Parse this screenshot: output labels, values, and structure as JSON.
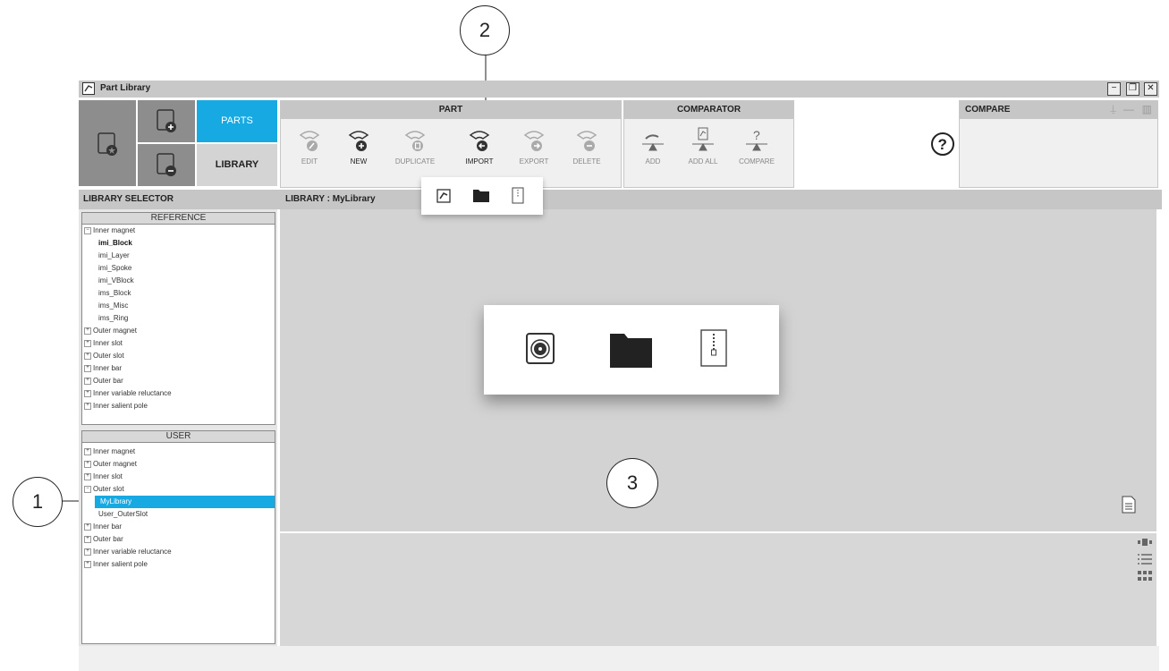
{
  "window": {
    "title": "Part Library"
  },
  "tiles": {
    "parts_label": "PARTS",
    "library_label": "LIBRARY"
  },
  "part": {
    "header": "PART",
    "buttons": [
      {
        "label": "EDIT",
        "enabled": false
      },
      {
        "label": "NEW",
        "enabled": true
      },
      {
        "label": "DUPLICATE",
        "enabled": false
      },
      {
        "label": "IMPORT",
        "enabled": true
      },
      {
        "label": "EXPORT",
        "enabled": false
      },
      {
        "label": "DELETE",
        "enabled": false
      }
    ]
  },
  "comparator": {
    "header": "COMPARATOR",
    "buttons": [
      {
        "label": "ADD"
      },
      {
        "label": "ADD ALL"
      },
      {
        "label": "COMPARE"
      }
    ]
  },
  "compare": {
    "header": "COMPARE"
  },
  "library_selector": {
    "header": "LIBRARY SELECTOR"
  },
  "library": {
    "header": "LIBRARY : MyLibrary"
  },
  "reference": {
    "header": "REFERENCE",
    "items": [
      {
        "label": "Inner magnet",
        "level": 0,
        "expanded": true
      },
      {
        "label": "imi_Block",
        "level": 1,
        "bold": true
      },
      {
        "label": "imi_Layer",
        "level": 1
      },
      {
        "label": "imi_Spoke",
        "level": 1
      },
      {
        "label": "imi_VBlock",
        "level": 1
      },
      {
        "label": "ims_Block",
        "level": 1
      },
      {
        "label": "ims_Misc",
        "level": 1
      },
      {
        "label": "ims_Ring",
        "level": 1
      },
      {
        "label": "Outer magnet",
        "level": 0
      },
      {
        "label": "Inner slot",
        "level": 0
      },
      {
        "label": "Outer slot",
        "level": 0
      },
      {
        "label": "Inner bar",
        "level": 0
      },
      {
        "label": "Outer bar",
        "level": 0
      },
      {
        "label": "Inner variable reluctance",
        "level": 0
      },
      {
        "label": "Inner salient pole",
        "level": 0
      }
    ]
  },
  "user": {
    "header": "USER",
    "items": [
      {
        "label": "Inner magnet",
        "level": 0
      },
      {
        "label": "Outer magnet",
        "level": 0
      },
      {
        "label": "Inner slot",
        "level": 0
      },
      {
        "label": "Outer slot",
        "level": 0,
        "expanded": true
      },
      {
        "label": "MyLibrary",
        "level": 1,
        "selected": true
      },
      {
        "label": "User_OuterSlot",
        "level": 1
      },
      {
        "label": "Inner bar",
        "level": 0
      },
      {
        "label": "Outer bar",
        "level": 0
      },
      {
        "label": "Inner variable reluctance",
        "level": 0
      },
      {
        "label": "Inner salient pole",
        "level": 0
      }
    ]
  },
  "callouts": {
    "one": "1",
    "two": "2",
    "three": "3"
  },
  "colors": {
    "accent": "#16a9e2",
    "panel": "#f0f0f0",
    "header": "#c6c6c6"
  }
}
